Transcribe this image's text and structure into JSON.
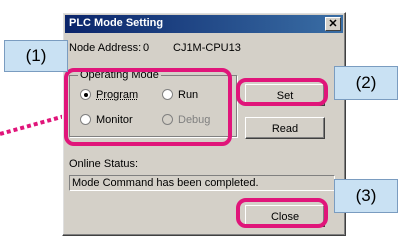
{
  "window": {
    "title": "PLC Mode Setting",
    "close_glyph": "✕"
  },
  "info": {
    "node_address_label": "Node Address:",
    "node_address_value": "0",
    "cpu_model": "CJ1M-CPU13"
  },
  "operating_mode": {
    "label": "Operating Mode",
    "options": [
      {
        "label": "Program",
        "selected": true,
        "enabled": true
      },
      {
        "label": "Run",
        "selected": false,
        "enabled": true
      },
      {
        "label": "Monitor",
        "selected": false,
        "enabled": true
      },
      {
        "label": "Debug",
        "selected": false,
        "enabled": false
      }
    ]
  },
  "buttons": {
    "set_label": "Set",
    "read_label": "Read",
    "close_label": "Close"
  },
  "online_status": {
    "label": "Online Status:",
    "value": "Mode Command has been completed."
  },
  "annotations": {
    "callout_1": "(1)",
    "callout_2": "(2)",
    "callout_3": "(3)",
    "highlight_color": "#e0157a",
    "callout_color": "#c9e1f3"
  }
}
